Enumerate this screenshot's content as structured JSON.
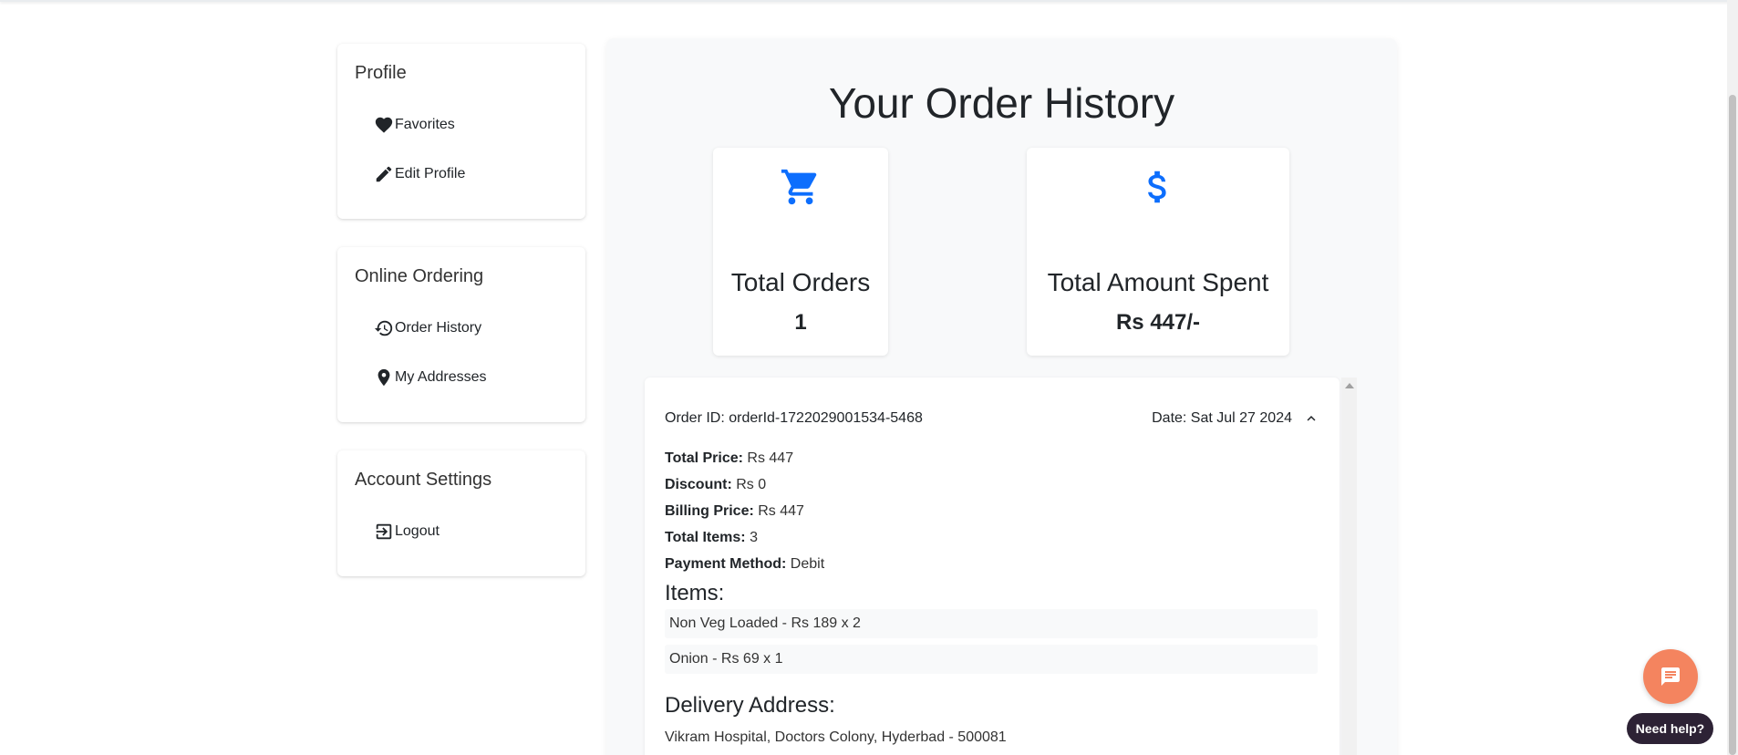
{
  "sidebar": {
    "profile": {
      "title": "Profile",
      "links": [
        "Favorites",
        "Edit Profile"
      ]
    },
    "ordering": {
      "title": "Online Ordering",
      "links": [
        "Order History",
        "My Addresses"
      ]
    },
    "account": {
      "title": "Account Settings",
      "links": [
        "Logout"
      ]
    }
  },
  "main": {
    "title": "Your Order History",
    "stats": {
      "orders": {
        "label": "Total Orders",
        "value": "1",
        "icon": "cart-icon"
      },
      "spent": {
        "label": "Total Amount Spent",
        "value": "Rs 447/-",
        "icon": "dollar-icon"
      }
    }
  },
  "order": {
    "id_label": "Order ID: orderId-1722029001534-5468",
    "date_label": "Date: Sat Jul 27 2024",
    "details": [
      {
        "label": "Total Price:",
        "value": "Rs 447"
      },
      {
        "label": "Discount:",
        "value": "Rs 0"
      },
      {
        "label": "Billing Price:",
        "value": "Rs 447"
      },
      {
        "label": "Total Items:",
        "value": "3"
      },
      {
        "label": "Payment Method:",
        "value": "Debit"
      }
    ],
    "items_heading": "Items:",
    "items": [
      "Non Veg Loaded - Rs 189 x 2",
      "Onion - Rs 69 x 1"
    ],
    "address_heading": "Delivery Address:",
    "address": "Vikram Hospital, Doctors Colony, Hyderbad - 500081"
  },
  "help": {
    "label": "Need help?"
  },
  "colors": {
    "accent": "#0d6efd",
    "chat": "#f4845f",
    "help_pill": "#2d2235"
  }
}
